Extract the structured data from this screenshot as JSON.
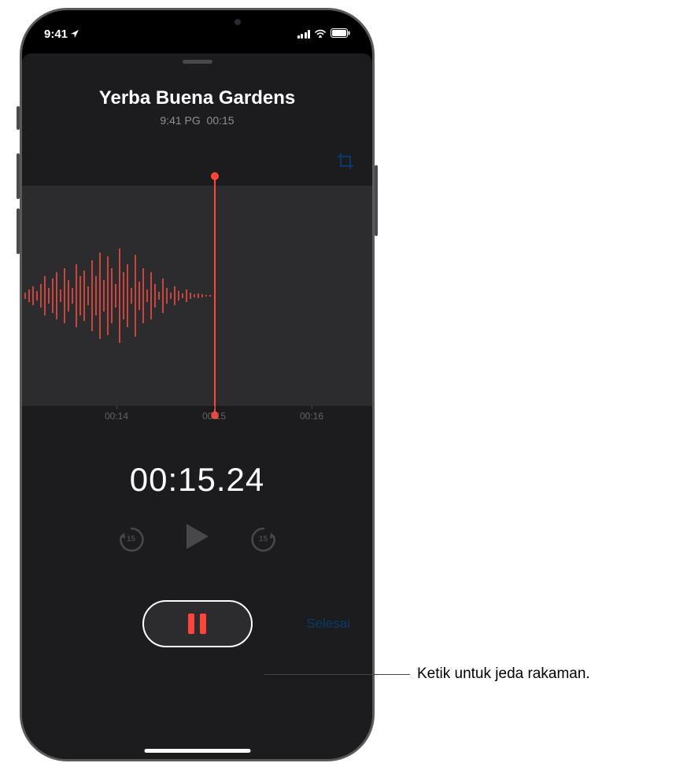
{
  "status": {
    "time": "9:41",
    "location_arrow": "↗"
  },
  "recording": {
    "title": "Yerba Buena Gardens",
    "timestamp": "9:41 PG",
    "duration": "00:15",
    "elapsed": "00:15.24"
  },
  "ruler": {
    "t1": "00:14",
    "t2": "00:15",
    "t3": "00:16"
  },
  "controls": {
    "skip_seconds": "15",
    "done_label": "Selesai"
  },
  "callout": {
    "text": "Ketik untuk jeda rakaman."
  }
}
